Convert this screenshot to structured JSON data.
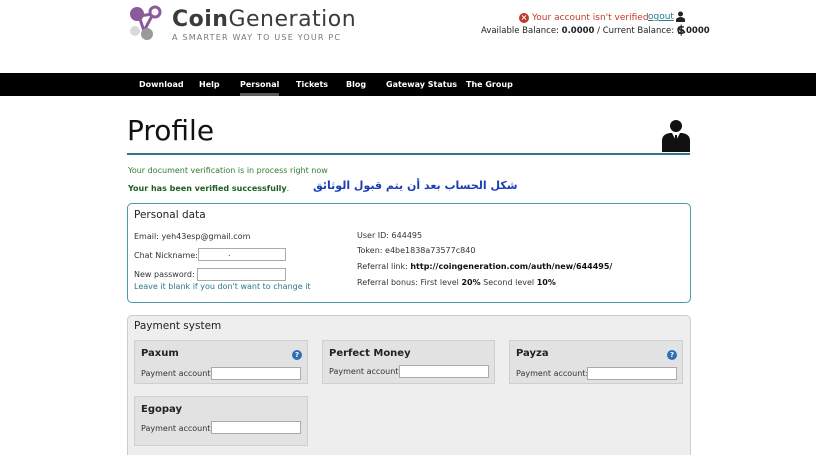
{
  "header": {
    "brand_prefix": "Coin",
    "brand_suffix": "Generation",
    "tagline": "A SMARTER WAY TO USE YOUR PC",
    "account_warning": "Your account isn't verified",
    "logout_label": "ogout",
    "available_label": "Available Balance:",
    "available_value": "0.0000",
    "current_label": "/ Current Balance:",
    "current_value": "0.0000",
    "currency_symbol": "$"
  },
  "nav": {
    "items": [
      "Download",
      "Help",
      "Personal",
      "Tickets",
      "Blog",
      "Gateway Status",
      "The Group"
    ],
    "active": "Personal"
  },
  "page": {
    "title": "Profile",
    "msg_process": "Your document verification is in process right now",
    "msg_verified": "Your has been verified successfully",
    "msg_verified_tail": ".",
    "arabic_note": "شكل الحساب بعد أن يتم قبول الوثائق"
  },
  "personal": {
    "title": "Personal data",
    "email_label": "Email:",
    "email_value": "yeh43esp@gmail.com",
    "nickname_label": "Chat Nickname:",
    "nickname_value": ".",
    "password_label": "New password:",
    "password_hint": "Leave it blank if you don't want to change it",
    "userid_label": "User ID:",
    "userid_value": "644495",
    "token_label": "Token:",
    "token_value": "e4be1838a73577c840",
    "referral_label": "Referral link:",
    "referral_value": "http://coingeneration.com/auth/new/644495/",
    "bonus_label": "Referral bonus: First level",
    "bonus_first": "20%",
    "bonus_second_label": "Second level",
    "bonus_second": "10%"
  },
  "payment": {
    "title": "Payment system",
    "account_label": "Payment account:",
    "systems": [
      "Paxum",
      "Perfect Money",
      "Payza",
      "Egopay"
    ],
    "help_glyph": "?"
  }
}
